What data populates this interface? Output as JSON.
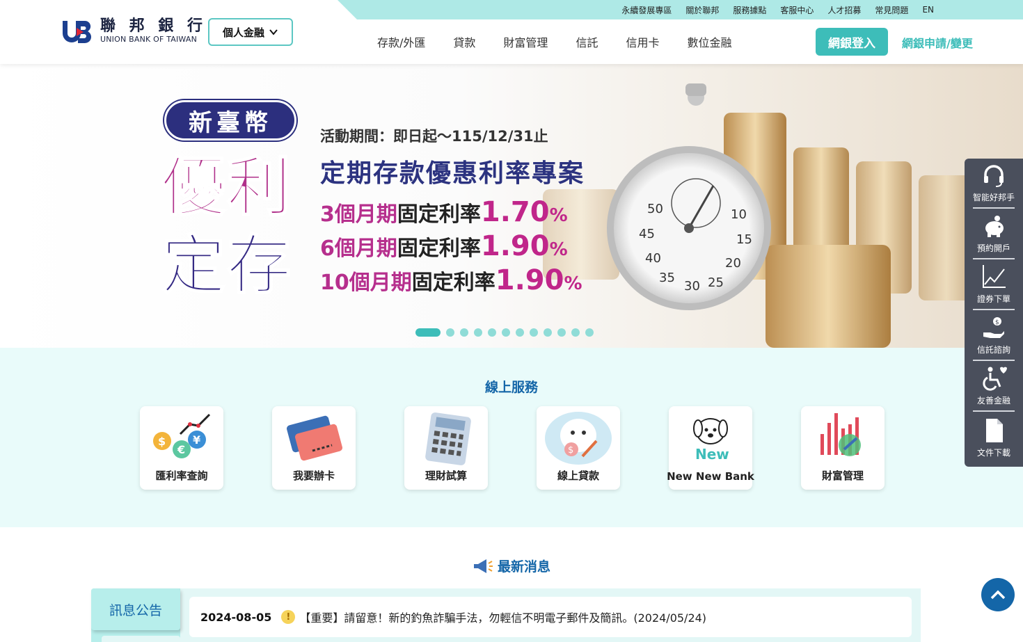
{
  "brand": {
    "name_zh": "聯 邦 銀 行",
    "name_en": "UNION BANK OF TAIWAN"
  },
  "persona_selector": "個人金融",
  "top_links": [
    "永續發展專區",
    "關於聯邦",
    "服務據點",
    "客服中心",
    "人才招募",
    "常見問題",
    "EN"
  ],
  "main_nav": [
    "存款/外匯",
    "貸款",
    "財富管理",
    "信託",
    "信用卡",
    "數位金融"
  ],
  "login_button": "網銀登入",
  "apply_link": "網銀申請/變更",
  "banner": {
    "tag": "新臺幣",
    "big_line1": "優利",
    "big_line2": "定存",
    "period": "活動期間：即日起～115/12/31止",
    "headline": "定期存款優惠利率專案",
    "rates": [
      {
        "term": "3個月期",
        "fixed": "固定利率",
        "value": "1.70",
        "unit": "%"
      },
      {
        "term": "6個月期",
        "fixed": "固定利率",
        "value": "1.90",
        "unit": "%"
      },
      {
        "term": "10個月期",
        "fixed": "固定利率",
        "value": "1.90",
        "unit": "%"
      }
    ],
    "slide_count": 12,
    "active_slide": 1
  },
  "online_services": {
    "title": "線上服務",
    "items": [
      {
        "label": "匯利率查詢",
        "icon": "currency-exchange-icon"
      },
      {
        "label": "我要辦卡",
        "icon": "credit-card-icon"
      },
      {
        "label": "理財試算",
        "icon": "calculator-icon"
      },
      {
        "label": "線上貸款",
        "icon": "loan-dog-icon"
      },
      {
        "label": "New New Bank",
        "icon": "new-new-bank-icon"
      },
      {
        "label": "財富管理",
        "icon": "wealth-chart-icon"
      }
    ]
  },
  "news": {
    "title": "最新消息",
    "tab": "訊息公告",
    "items": [
      {
        "date": "2024-08-05",
        "text": "【重要】請留意！新的釣魚詐騙手法，勿輕信不明電子郵件及簡訊。(2024/05/24)"
      }
    ]
  },
  "side_menu": [
    {
      "label": "智能好邦手",
      "icon": "headset-icon"
    },
    {
      "label": "預約開戶",
      "icon": "piggy-bank-icon"
    },
    {
      "label": "證券下單",
      "icon": "line-chart-icon"
    },
    {
      "label": "信託諮詢",
      "icon": "hand-coin-icon"
    },
    {
      "label": "友善金融",
      "icon": "accessibility-icon"
    },
    {
      "label": "文件下載",
      "icon": "document-icon"
    }
  ],
  "colors": {
    "accent": "#3dbdb9",
    "topbar": "#aee9e6",
    "title_blue": "#1466a8",
    "services_bg": "#e9fbfa",
    "side_menu_bg": "#4a4f5c"
  }
}
